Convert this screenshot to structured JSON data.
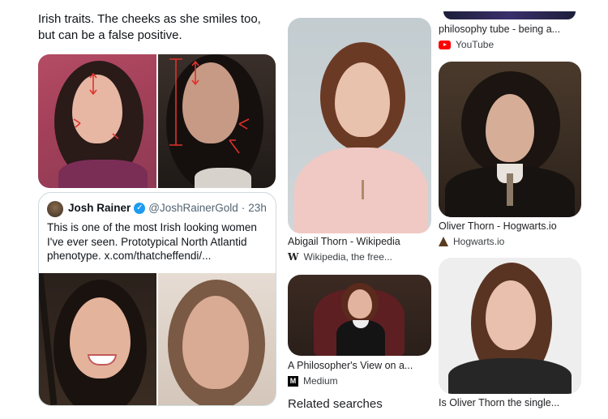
{
  "left_column": {
    "intro_text": "Irish traits. The cheeks as she smiles too, but can be a false positive.",
    "tweet": {
      "author_name": "Josh Rainer",
      "verified_badge": "verified-badge-icon",
      "handle": "@JoshRainerGold",
      "separator": "·",
      "time_ago": "23h",
      "body": "This is one of the most Irish looking women I've ever seen. Prototypical North Atlantid phenotype.",
      "link": "x.com/thatcheffendi/...",
      "link_color": "#0f1419"
    }
  },
  "results": {
    "r1": {
      "title": "philosophy tube - being a...",
      "source": "YouTube",
      "source_icon": "youtube-icon",
      "icon_color": "#ff0000"
    },
    "r2": {
      "title": "Abigail Thorn - Wikipedia",
      "source": "Wikipedia, the free...",
      "source_icon": "wikipedia-icon"
    },
    "r3": {
      "title": "Oliver Thorn - Hogwarts.io",
      "source": "Hogwarts.io",
      "source_icon": "wizard-hat-icon"
    },
    "r4": {
      "title": "A Philosopher's View on a...",
      "source": "Medium",
      "source_icon": "medium-icon"
    },
    "r5": {
      "title": "Is Oliver Thorn the single..."
    }
  },
  "related_searches": "Related searches",
  "colors": {
    "verified": "#1d9bf0",
    "annotation_red": "#e0312b",
    "card_border": "#cfd9de"
  }
}
